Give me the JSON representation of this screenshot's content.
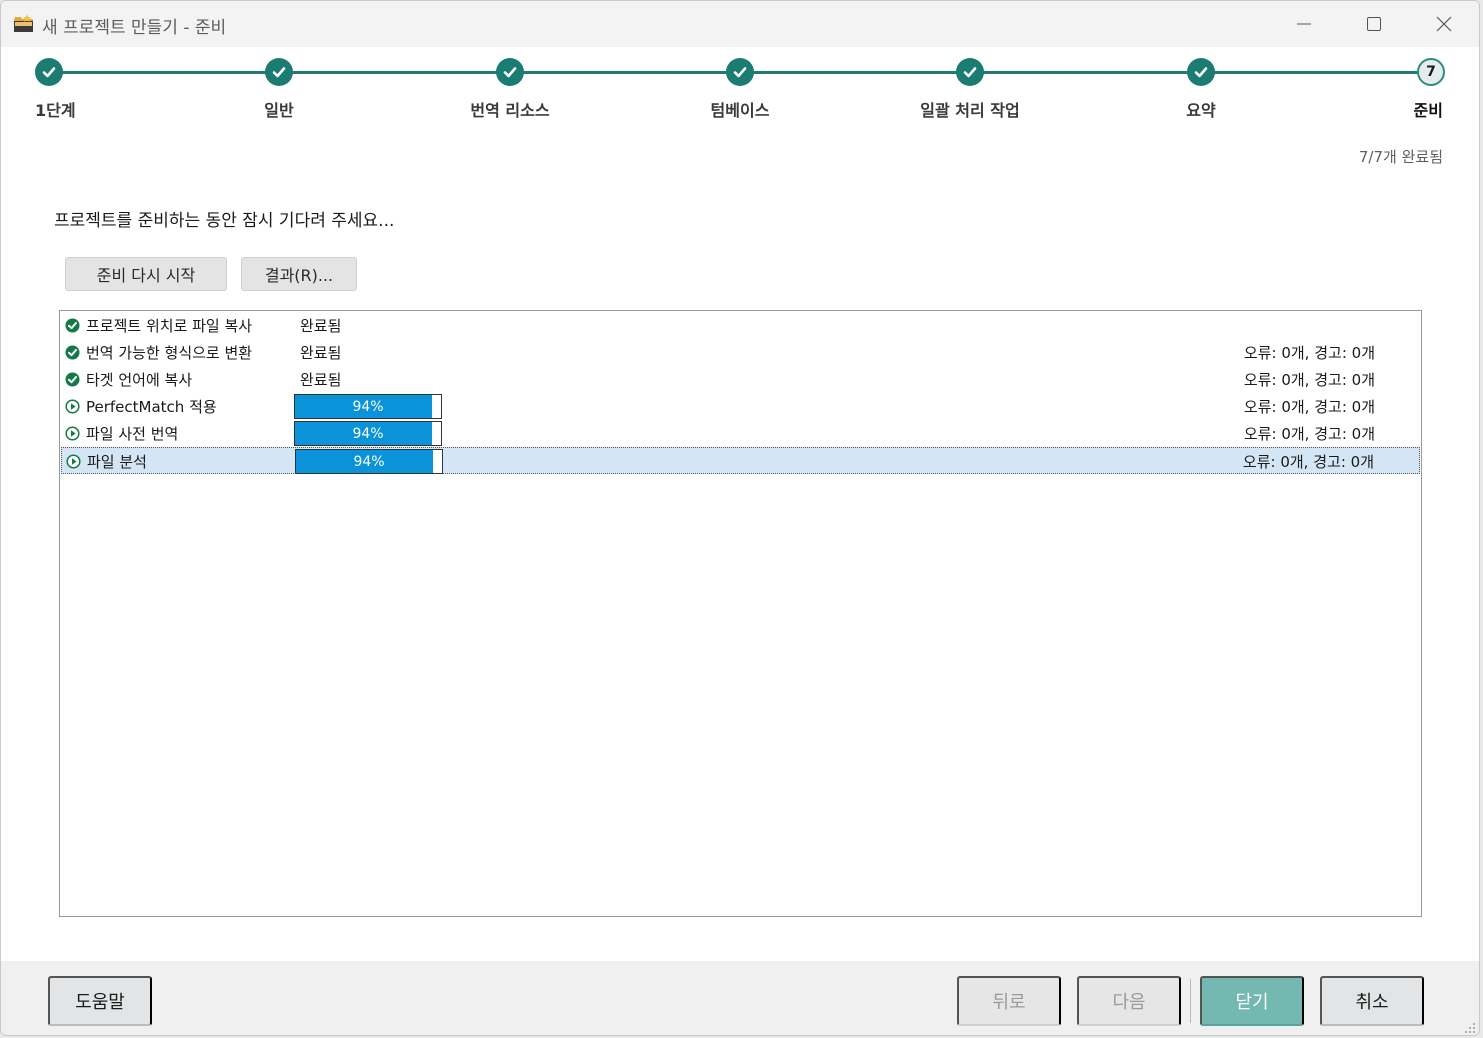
{
  "window": {
    "title": "새 프로젝트 만들기 - 준비"
  },
  "steps": [
    {
      "label": "1단계",
      "status": "done"
    },
    {
      "label": "일반",
      "status": "done"
    },
    {
      "label": "번역 리소스",
      "status": "done"
    },
    {
      "label": "텀베이스",
      "status": "done"
    },
    {
      "label": "일괄 처리 작업",
      "status": "done"
    },
    {
      "label": "요약",
      "status": "done"
    },
    {
      "label": "준비",
      "status": "current",
      "number": "7"
    }
  ],
  "completed_count": "7/7개 완료됨",
  "wait_message": "프로젝트를 준비하는 동안 잠시 기다려 주세요...",
  "buttons": {
    "restart": "준비 다시 시작",
    "results": "결과(R)..."
  },
  "tasks": [
    {
      "name": "프로젝트 위치로 파일 복사",
      "status": "완료됨",
      "errors": "",
      "state": "done"
    },
    {
      "name": "번역 가능한 형식으로 변환",
      "status": "완료됨",
      "errors": "오류: 0개, 경고: 0개",
      "state": "done"
    },
    {
      "name": "타겟 언어에 복사",
      "status": "완료됨",
      "errors": "오류: 0개, 경고: 0개",
      "state": "done"
    },
    {
      "name": "PerfectMatch 적용",
      "progress": 94,
      "progress_label": "94%",
      "errors": "오류: 0개, 경고: 0개",
      "state": "running"
    },
    {
      "name": "파일 사전 번역",
      "progress": 94,
      "progress_label": "94%",
      "errors": "오류: 0개, 경고: 0개",
      "state": "running"
    },
    {
      "name": "파일 분석",
      "progress": 94,
      "progress_label": "94%",
      "errors": "오류: 0개, 경고: 0개",
      "state": "running",
      "selected": true
    }
  ],
  "footer": {
    "help": "도움말",
    "back": "뒤로",
    "next": "다음",
    "close": "닫기",
    "cancel": "취소"
  },
  "colors": {
    "accent": "#1b7c72",
    "progress": "#0a93d8",
    "selected_row": "#d4e6f5",
    "primary_button": "#74b9b1"
  },
  "icons": {
    "app": "folder-star-icon",
    "done": "check-circle-icon",
    "running": "play-circle-icon"
  }
}
